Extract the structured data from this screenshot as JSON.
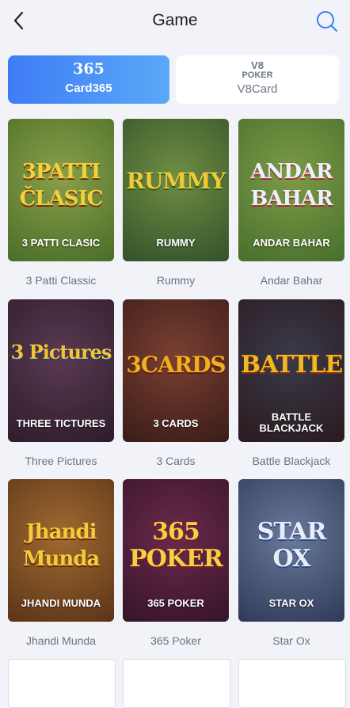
{
  "header": {
    "title": "Game"
  },
  "tabs": [
    {
      "logo_main": "365",
      "label": "Card365",
      "active": true
    },
    {
      "logo_main": "V8",
      "logo_sub": "POKER",
      "label": "V8Card",
      "active": false
    }
  ],
  "games": [
    {
      "caption": "3 PATTI CLASIC",
      "logo": "3PATTI ČLASIC",
      "label": "3 Patti Classic",
      "bg1": "#7b8d3a",
      "bg2": "#4e7a2b"
    },
    {
      "caption": "RUMMY",
      "logo": "RUMMY",
      "label": "Rummy",
      "bg1": "#5f7e3a",
      "bg2": "#3b5a2a"
    },
    {
      "caption": "ANDAR BAHAR",
      "logo": "ANDAR BAHAR",
      "label": "Andar Bahar",
      "bg1": "#6b8a3c",
      "bg2": "#4a7a2e"
    },
    {
      "caption": "THREE TICTURES",
      "logo": "3 Pictures",
      "label": "Three Pictures",
      "bg1": "#3a2a3c",
      "bg2": "#5a2a2e"
    },
    {
      "caption": "3 CARDS",
      "logo": "3CARDS",
      "label": "3 Cards",
      "bg1": "#5a3328",
      "bg2": "#3a1e1c"
    },
    {
      "caption": "BATTLE BLACKJACK",
      "logo": "BATTLE",
      "label": "Battle Blackjack",
      "bg1": "#2b2e3a",
      "bg2": "#3a1e22"
    },
    {
      "caption": "JHANDI MUNDA",
      "logo": "Jhandi Munda",
      "label": "Jhandi Munda",
      "bg1": "#8a5a2a",
      "bg2": "#5a3418"
    },
    {
      "caption": "365 POKER",
      "logo": "365 POKER",
      "label": "365 Poker",
      "bg1": "#5a1e3a",
      "bg2": "#3a1530"
    },
    {
      "caption": "STAR OX",
      "logo": "STAR OX",
      "label": "Star Ox",
      "bg1": "#5a6a8a",
      "bg2": "#2e3a5a"
    }
  ]
}
